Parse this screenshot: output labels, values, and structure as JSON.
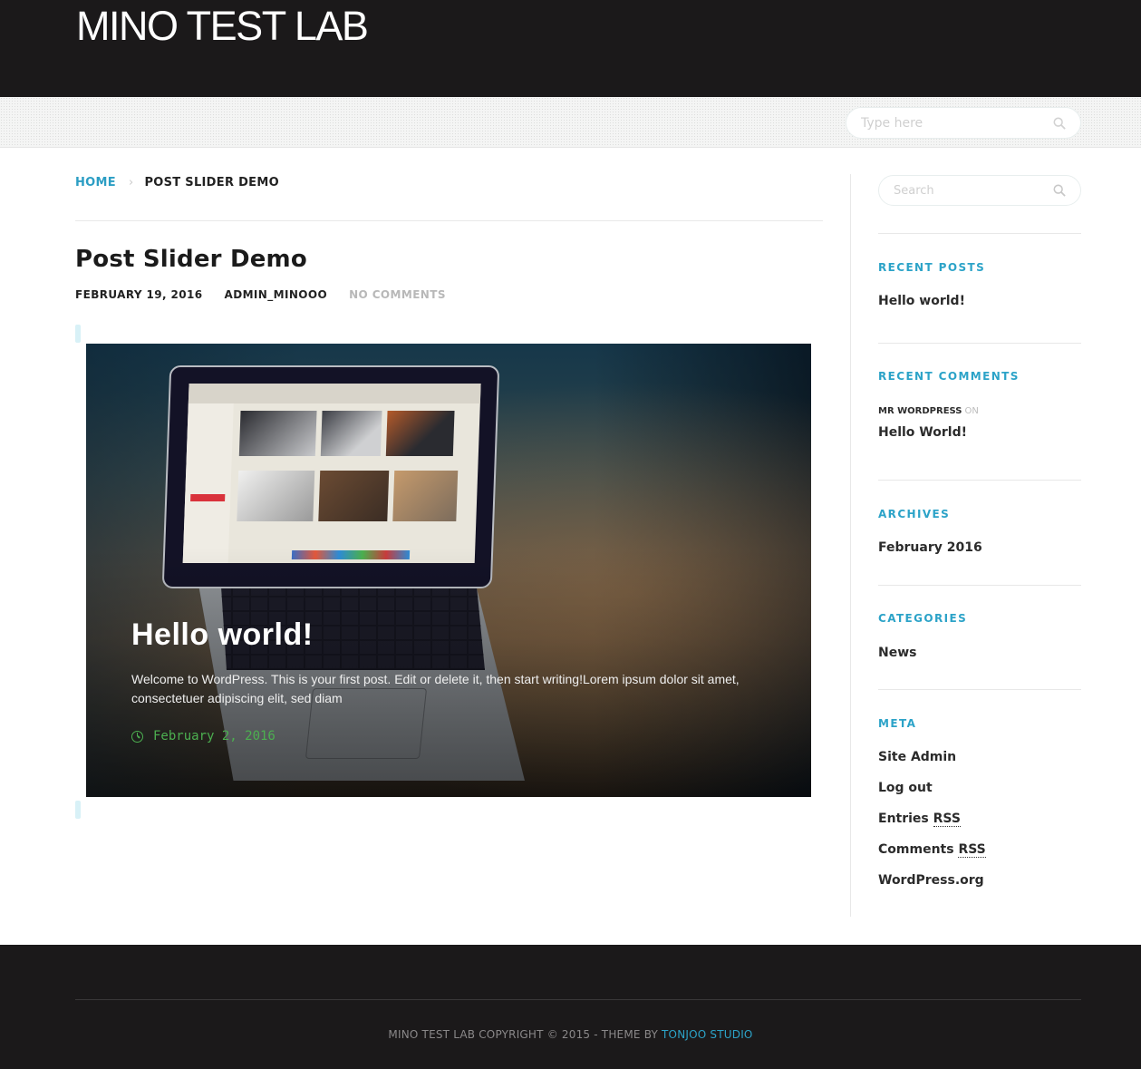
{
  "header": {
    "site_title": "MINO TEST LAB"
  },
  "nav": {
    "search_placeholder": "Type here",
    "search_icon": "magnifier-icon"
  },
  "breadcrumb": {
    "home": "HOME",
    "separator": "›",
    "current": "POST SLIDER DEMO"
  },
  "post": {
    "title": "Post Slider Demo",
    "date": "FEBRUARY 19, 2016",
    "author": "ADMIN_MINOOO",
    "comments": "NO COMMENTS"
  },
  "slide": {
    "title": "Hello world!",
    "excerpt": "Welcome to WordPress. This is your first post. Edit or delete it, then start writing!Lorem ipsum dolor sit amet, consectetuer adipiscing elit, sed diam",
    "date": "February 2, 2016",
    "date_icon": "clock-icon",
    "date_color": "#4caf50"
  },
  "sidebar": {
    "search_placeholder": "Search",
    "recent_posts": {
      "title": "RECENT POSTS",
      "items": [
        "Hello world!"
      ]
    },
    "recent_comments": {
      "title": "RECENT COMMENTS",
      "author": "MR WORDPRESS",
      "on": "ON",
      "post": "Hello World!"
    },
    "archives": {
      "title": "ARCHIVES",
      "items": [
        "February 2016"
      ]
    },
    "categories": {
      "title": "CATEGORIES",
      "items": [
        "News"
      ]
    },
    "meta": {
      "title": "META",
      "site_admin": "Site Admin",
      "log_out": "Log out",
      "entries": "Entries",
      "comments": "Comments",
      "rss": "RSS",
      "wordpress_org": "WordPress.org"
    }
  },
  "footer": {
    "copyright": "MINO TEST LAB COPYRIGHT © 2015 - THEME BY",
    "studio_link": "TONJOO STUDIO"
  },
  "colors": {
    "accent": "#2ca3c8",
    "header_bg": "#1b191a",
    "text_dark": "#2b2b2b"
  }
}
